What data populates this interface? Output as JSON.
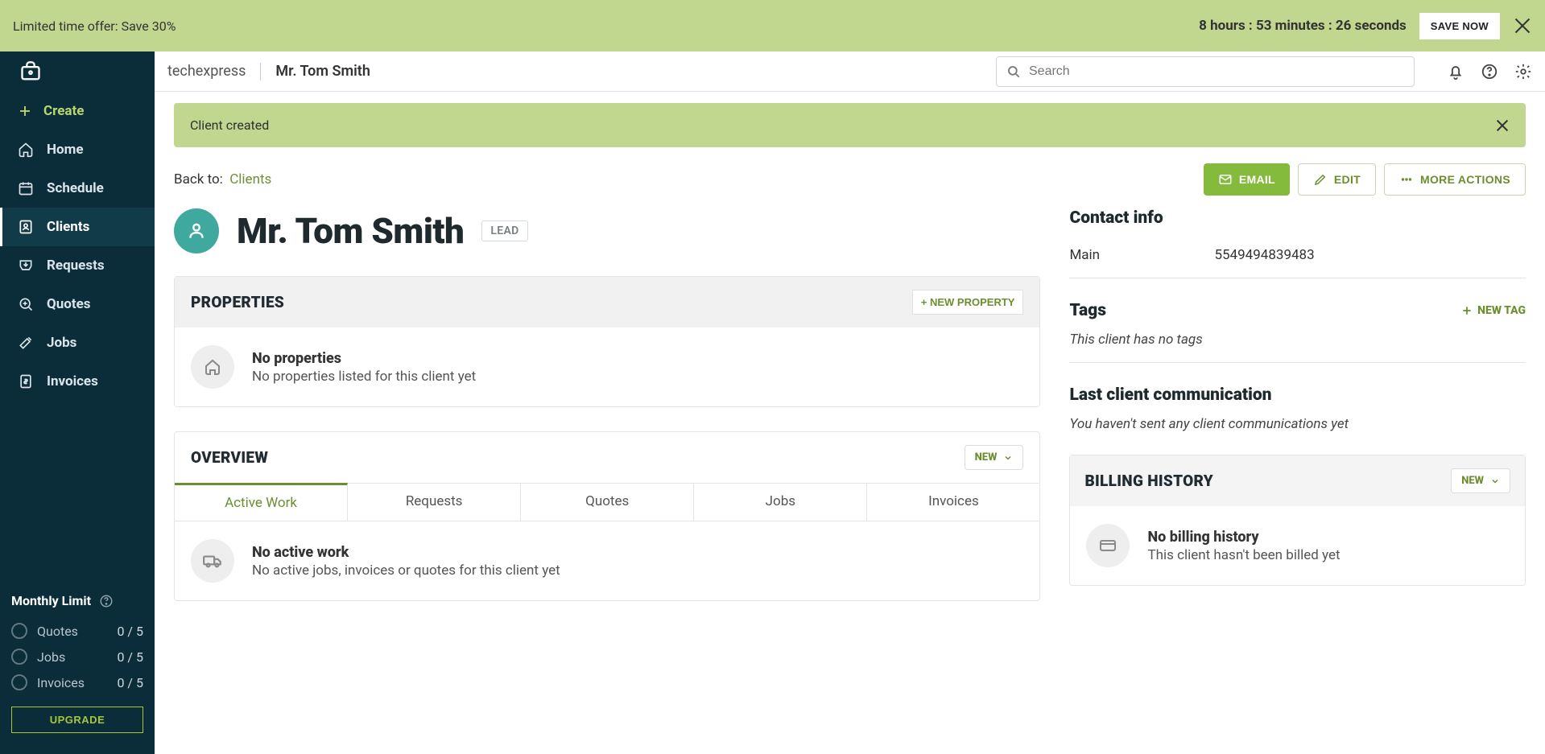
{
  "promo": {
    "text": "Limited time offer: Save 30%",
    "countdown": "8 hours : 53 minutes : 26 seconds",
    "save_label": "SAVE NOW"
  },
  "topbar": {
    "company": "techexpress",
    "page": "Mr. Tom Smith",
    "search_placeholder": "Search"
  },
  "sidebar": {
    "create_label": "Create",
    "items": [
      {
        "label": "Home"
      },
      {
        "label": "Schedule"
      },
      {
        "label": "Clients"
      },
      {
        "label": "Requests"
      },
      {
        "label": "Quotes"
      },
      {
        "label": "Jobs"
      },
      {
        "label": "Invoices"
      }
    ],
    "monthly_limit": {
      "title": "Monthly Limit",
      "items": [
        {
          "label": "Quotes",
          "count": "0 / 5"
        },
        {
          "label": "Jobs",
          "count": "0 / 5"
        },
        {
          "label": "Invoices",
          "count": "0 / 5"
        }
      ],
      "upgrade_label": "UPGRADE"
    }
  },
  "alert": {
    "message": "Client created"
  },
  "backto": {
    "prefix": "Back to:",
    "link": "Clients"
  },
  "actions": {
    "email": "EMAIL",
    "edit": "EDIT",
    "more": "MORE ACTIONS"
  },
  "client": {
    "name": "Mr. Tom Smith",
    "badge": "LEAD"
  },
  "properties": {
    "title": "PROPERTIES",
    "new_label": "+ NEW PROPERTY",
    "empty_title": "No properties",
    "empty_sub": "No properties listed for this client yet"
  },
  "overview": {
    "title": "OVERVIEW",
    "new_label": "NEW",
    "tabs": [
      "Active Work",
      "Requests",
      "Quotes",
      "Jobs",
      "Invoices"
    ],
    "empty_title": "No active work",
    "empty_sub": "No active jobs, invoices or quotes for this client yet"
  },
  "contact": {
    "title": "Contact info",
    "rows": [
      {
        "label": "Main",
        "value": "5549494839483"
      }
    ]
  },
  "tags": {
    "title": "Tags",
    "new_label": "NEW TAG",
    "empty": "This client has no tags"
  },
  "lastcomm": {
    "title": "Last client communication",
    "empty": "You haven't sent any client communications yet"
  },
  "billing": {
    "title": "BILLING HISTORY",
    "new_label": "NEW",
    "empty_title": "No billing history",
    "empty_sub": "This client hasn't been billed yet"
  }
}
